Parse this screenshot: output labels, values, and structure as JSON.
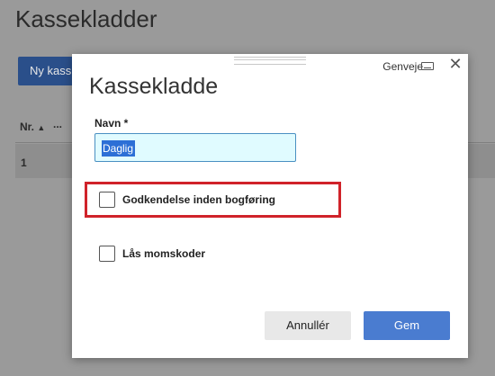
{
  "background": {
    "title": "Kassekladder",
    "new_button_label": "Ny kass",
    "columns": {
      "nr": "Nr.",
      "sort_icon": "▲",
      "more": "..."
    },
    "rows": [
      {
        "nr": "1"
      }
    ]
  },
  "dialog": {
    "title": "Kassekladde",
    "shortcuts_label": "Genveje",
    "close_glyph": "✕",
    "name_label": "Navn *",
    "name_value": "Daglig",
    "checkbox_approval_label": "Godkendelse inden bogføring",
    "checkbox_approval_checked": false,
    "checkbox_vat_label": "Lås momskoder",
    "checkbox_vat_checked": false,
    "cancel_label": "Annullér",
    "save_label": "Gem"
  },
  "colors": {
    "primary": "#4a7cd0",
    "highlight": "#d0232a",
    "input_bg": "#e0fbff"
  }
}
